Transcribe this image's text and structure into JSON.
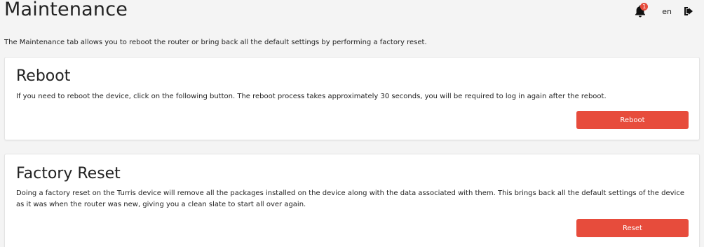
{
  "header": {
    "title": "Maintenance",
    "notification_count": "1",
    "language": "en"
  },
  "intro": "The Maintenance tab allows you to reboot the router or bring back all the default settings by performing a factory reset.",
  "reboot": {
    "title": "Reboot",
    "description": "If you need to reboot the device, click on the following button. The reboot process takes approximately 30 seconds, you will be required to log in again after the reboot.",
    "button_label": "Reboot"
  },
  "factory_reset": {
    "title": "Factory Reset",
    "description": "Doing a factory reset on the Turris device will remove all the packages installed on the device along with the data associated with them. This brings back all the default settings of the device as it was when the router was new, giving you a clean slate to start all over again.",
    "button_label": "Reset"
  },
  "icons": {
    "notifications": "bell-icon",
    "logout": "logout-icon"
  },
  "colors": {
    "accent": "#e74c3c",
    "background": "#f4f4f4",
    "card": "#ffffff"
  }
}
